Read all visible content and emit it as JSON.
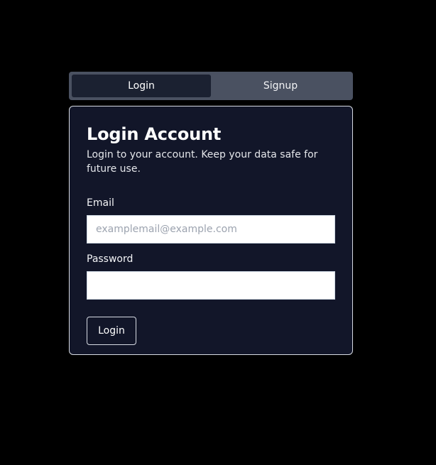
{
  "tabs": [
    {
      "label": "Login",
      "active": true
    },
    {
      "label": "Signup",
      "active": false
    }
  ],
  "card": {
    "title": "Login Account",
    "description": "Login to your account. Keep your data safe for future use."
  },
  "form": {
    "email_label": "Email",
    "email_placeholder": "examplemail@example.com",
    "email_value": "",
    "password_label": "Password",
    "password_value": "",
    "submit_label": "Login"
  },
  "colors": {
    "page_background": "#000000",
    "card_background": "#121629",
    "tab_bar_background": "#4a5161",
    "active_tab_background": "#1b2131",
    "border": "#d7dbe3",
    "text": "#ffffff"
  }
}
